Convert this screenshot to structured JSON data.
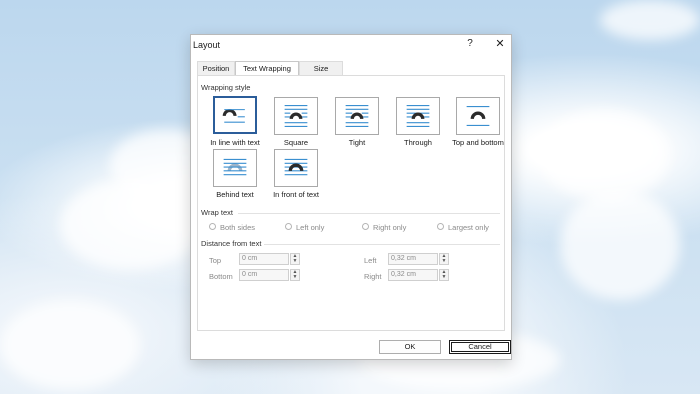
{
  "dialog": {
    "title": "Layout",
    "help_label": "?",
    "close_label": "✕"
  },
  "tabs": [
    {
      "label": "Position",
      "active": false
    },
    {
      "label": "Text Wrapping",
      "active": true
    },
    {
      "label": "Size",
      "active": false
    }
  ],
  "wrapping_style": {
    "heading": "Wrapping style",
    "options": [
      {
        "label": "In line with text",
        "icon": "inline-with-text-icon",
        "selected": true
      },
      {
        "label": "Square",
        "icon": "square-wrap-icon",
        "selected": false
      },
      {
        "label": "Tight",
        "icon": "tight-wrap-icon",
        "selected": false
      },
      {
        "label": "Through",
        "icon": "through-wrap-icon",
        "selected": false
      },
      {
        "label": "Top and bottom",
        "icon": "top-and-bottom-wrap-icon",
        "selected": false
      },
      {
        "label": "Behind text",
        "icon": "behind-text-icon",
        "selected": false
      },
      {
        "label": "In front of text",
        "icon": "in-front-of-text-icon",
        "selected": false
      }
    ]
  },
  "wrap_text": {
    "heading": "Wrap text",
    "options": [
      "Both sides",
      "Left only",
      "Right only",
      "Largest only"
    ]
  },
  "distance": {
    "heading": "Distance from text",
    "top_label": "Top",
    "top_value": "0 cm",
    "bottom_label": "Bottom",
    "bottom_value": "0 cm",
    "left_label": "Left",
    "left_value": "0,32 cm",
    "right_label": "Right",
    "right_value": "0,32 cm"
  },
  "buttons": {
    "ok": "OK",
    "cancel": "Cancel"
  },
  "colors": {
    "accent": "#2b5d9a",
    "line_blue": "#3a8fd0",
    "shape_dark": "#2b2b2b"
  }
}
